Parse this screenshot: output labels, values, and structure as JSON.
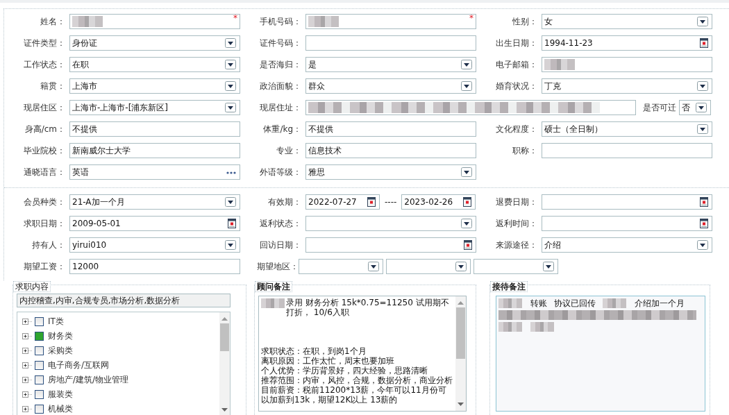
{
  "sections": [
    {
      "rows": [
        {
          "cells": [
            {
              "label": "姓名：",
              "kind": "text",
              "redacted": true,
              "required_mark": "*"
            },
            {
              "label": "手机号码：",
              "kind": "text",
              "redacted": true,
              "required_mark": "*"
            },
            {
              "label": "性别：",
              "kind": "select",
              "value": "女"
            }
          ]
        },
        {
          "cells": [
            {
              "label": "证件类型：",
              "kind": "select",
              "value": "身份证"
            },
            {
              "label": "证件号码：",
              "kind": "text"
            },
            {
              "label": "出生日期：",
              "kind": "date",
              "value": "1994-11-23"
            }
          ]
        },
        {
          "cells": [
            {
              "label": "工作状态：",
              "kind": "select",
              "value": "在职"
            },
            {
              "label": "是否海归：",
              "kind": "select",
              "value": "是"
            },
            {
              "label": "电子邮箱：",
              "kind": "text",
              "redacted": true
            }
          ]
        },
        {
          "cells": [
            {
              "label": "籍贯：",
              "kind": "select",
              "value": "上海市"
            },
            {
              "label": "政治面貌：",
              "kind": "select",
              "value": "群众"
            },
            {
              "label": "婚育状况：",
              "kind": "select",
              "value": "丁克"
            }
          ]
        },
        {
          "cells": [
            {
              "label": "现居住区：",
              "kind": "select",
              "value": " 上海市-上海市-[浦东新区]"
            },
            {
              "label": "现居住址：",
              "kind": "address",
              "redacted": true,
              "extra": {
                "label": "是否可迁",
                "value": "否"
              }
            }
          ]
        },
        {
          "cells": [
            {
              "label": "身高/cm：",
              "kind": "text",
              "value": "不提供"
            },
            {
              "label": "体重/kg：",
              "kind": "text",
              "value": "不提供"
            },
            {
              "label": "文化程度：",
              "kind": "select",
              "value": "硕士（全日制）"
            }
          ]
        },
        {
          "cells": [
            {
              "label": "毕业院校：",
              "kind": "text",
              "value": "新南威尔士大学"
            },
            {
              "label": "专业：",
              "kind": "text",
              "value": "信息技术"
            },
            {
              "label": "职称：",
              "kind": "text"
            }
          ]
        },
        {
          "cells": [
            {
              "label": "通晓语言：",
              "kind": "picker",
              "value": "英语"
            },
            {
              "label": "外语等级：",
              "kind": "select",
              "value": "雅思"
            }
          ]
        }
      ]
    },
    {
      "rows": [
        {
          "cells": [
            {
              "label": "会员种类：",
              "kind": "select",
              "value": " 21-A加一个月"
            },
            {
              "label": "有效期：",
              "kind": "range",
              "from": "2022-07-27",
              "separator": "----",
              "to": "2023-02-26"
            },
            {
              "label": "退费日期：",
              "kind": "date"
            }
          ]
        },
        {
          "cells": [
            {
              "label": "求职日期：",
              "kind": "date",
              "value": "2009-05-01"
            },
            {
              "label": "返利状态：",
              "kind": "select"
            },
            {
              "label": "返利时间：",
              "kind": "date"
            }
          ]
        },
        {
          "cells": [
            {
              "label": "持有人：",
              "kind": "select",
              "value": "yirui010"
            },
            {
              "label": "回访日期：",
              "kind": "date"
            },
            {
              "label": "来源途径：",
              "kind": "select",
              "value": "介绍"
            }
          ]
        },
        {
          "cells": [
            {
              "label": "期望工资：",
              "kind": "text",
              "value": "12000"
            },
            {
              "label": "期望地区：",
              "kind": "multi-select",
              "selects": [
                {
                  "kind": "select"
                },
                {
                  "kind": "select"
                },
                {
                  "kind": "select"
                }
              ]
            }
          ]
        }
      ]
    }
  ],
  "job_categories": {
    "legend": "求职内容",
    "summary": "内控稽查,内审,合规专员,市场分析,数据分析",
    "items": [
      {
        "label": "IT类",
        "expanded": false,
        "checked": false
      },
      {
        "label": "财务类",
        "expanded": false,
        "checked": true
      },
      {
        "label": "采购类",
        "expanded": false,
        "checked": false
      },
      {
        "label": "电子商务/互联网",
        "expanded": false,
        "checked": false
      },
      {
        "label": "房地产/建筑/物业管理",
        "expanded": false,
        "checked": false
      },
      {
        "label": "服装类",
        "expanded": false,
        "checked": false
      },
      {
        "label": "机械类",
        "expanded": false,
        "checked": false
      }
    ]
  },
  "advisor_notes": {
    "legend": "顾问备注",
    "paragraphs": [
      {
        "redacted_prefix": true,
        "text": "录用 财务分析  15k*0.75=11250  试用期不打折， 10/6入职"
      },
      {
        "kind": "blank"
      },
      {
        "text": "求职状态：在职，到岗1个月"
      },
      {
        "text": "离职原因：工作太忙，周末也要加班"
      },
      {
        "text": "个人优势：学历背景好，四大经验，思路清晰"
      },
      {
        "text": "推荐范围：内审，风控，合规，数据分析，商业分析"
      },
      {
        "text": "目前薪资：税前11200*13薪，今年可以11月份可以加薪到13k，期望12K以上 13薪的"
      }
    ]
  },
  "reception_notes": {
    "legend": "接待备注",
    "lines": [
      {
        "segments": [
          {
            "kind": "redacted"
          },
          {
            "kind": "text",
            "text": "转账"
          },
          {
            "kind": "text",
            "text": "协议已回传"
          },
          {
            "kind": "redacted"
          },
          {
            "kind": "text",
            "text": "介绍加一个月"
          }
        ]
      },
      {
        "segments": [
          {
            "kind": "redacted-long"
          }
        ]
      },
      {
        "segments": [
          {
            "kind": "redacted"
          },
          {
            "kind": "redacted"
          }
        ]
      }
    ]
  }
}
